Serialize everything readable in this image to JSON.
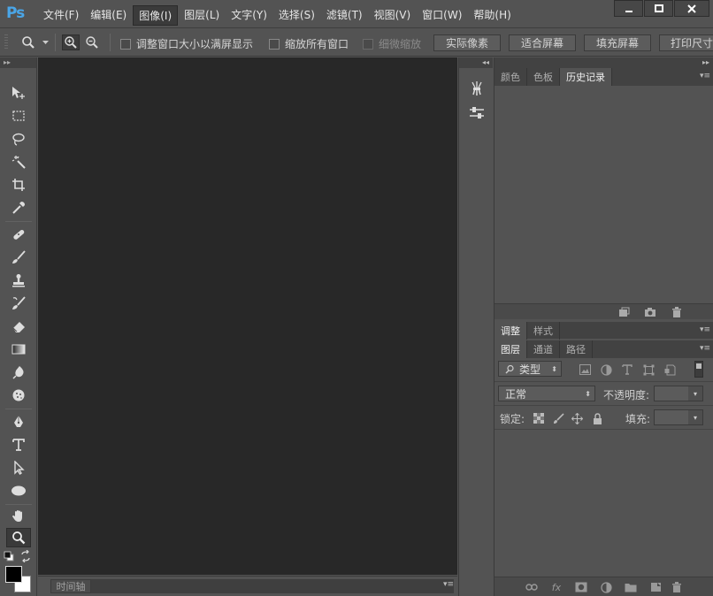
{
  "app": {
    "logo": "Ps"
  },
  "menu": {
    "items": [
      {
        "label": "文件(F)"
      },
      {
        "label": "编辑(E)"
      },
      {
        "label": "图像(I)",
        "active": true
      },
      {
        "label": "图层(L)"
      },
      {
        "label": "文字(Y)"
      },
      {
        "label": "选择(S)"
      },
      {
        "label": "滤镜(T)"
      },
      {
        "label": "视图(V)"
      },
      {
        "label": "窗口(W)"
      },
      {
        "label": "帮助(H)"
      }
    ]
  },
  "options": {
    "resize_windows": "调整窗口大小以满屏显示",
    "zoom_all": "缩放所有窗口",
    "scrubby_zoom": "细微缩放",
    "actual_pixels": "实际像素",
    "fit_screen": "适合屏幕",
    "fill_screen": "填充屏幕",
    "print_size": "打印尺寸"
  },
  "timeline": {
    "tab": "时间轴"
  },
  "panels": {
    "top_tabs": [
      "颜色",
      "色板",
      "历史记录"
    ],
    "mid_tabs": [
      "调整",
      "样式"
    ],
    "layer_tabs": [
      "图层",
      "通道",
      "路径"
    ]
  },
  "layers": {
    "filter_kind": "类型",
    "blend_mode": "正常",
    "opacity_label": "不透明度:",
    "lock_label": "锁定:",
    "fill_label": "填充:"
  },
  "colors": {
    "foreground": "#000000",
    "background": "#ffffff",
    "accent": "#4aa6e8"
  }
}
